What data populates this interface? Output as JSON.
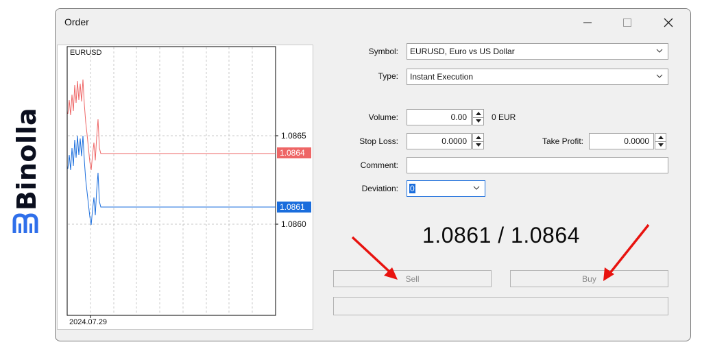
{
  "brand": {
    "name": "Binolla",
    "logo_icon": "binolla-logo-icon",
    "accent": "#2f6fea"
  },
  "window": {
    "title": "Order",
    "controls": [
      "minimize-icon",
      "maximize-icon",
      "close-icon"
    ]
  },
  "chart": {
    "symbol": "EURUSD",
    "date_label": "2024.07.29",
    "price_labels": [
      "1.0865",
      "1.0860"
    ],
    "ask_marker": "1.0864",
    "bid_marker": "1.0861",
    "ask_color": "#ee6666",
    "bid_color": "#1a6ddc"
  },
  "form": {
    "symbol_label": "Symbol:",
    "symbol_value": "EURUSD, Euro vs US Dollar",
    "type_label": "Type:",
    "type_value": "Instant Execution",
    "volume_label": "Volume:",
    "volume_value": "0.00",
    "volume_unit": "0 EUR",
    "stop_loss_label": "Stop Loss:",
    "stop_loss_value": "0.0000",
    "take_profit_label": "Take Profit:",
    "take_profit_value": "0.0000",
    "comment_label": "Comment:",
    "comment_value": "",
    "deviation_label": "Deviation:",
    "deviation_value": "0"
  },
  "quote": {
    "text": "1.0861 / 1.0864"
  },
  "actions": {
    "sell_label": "Sell",
    "buy_label": "Buy"
  },
  "annotation_color": "#e8130f"
}
